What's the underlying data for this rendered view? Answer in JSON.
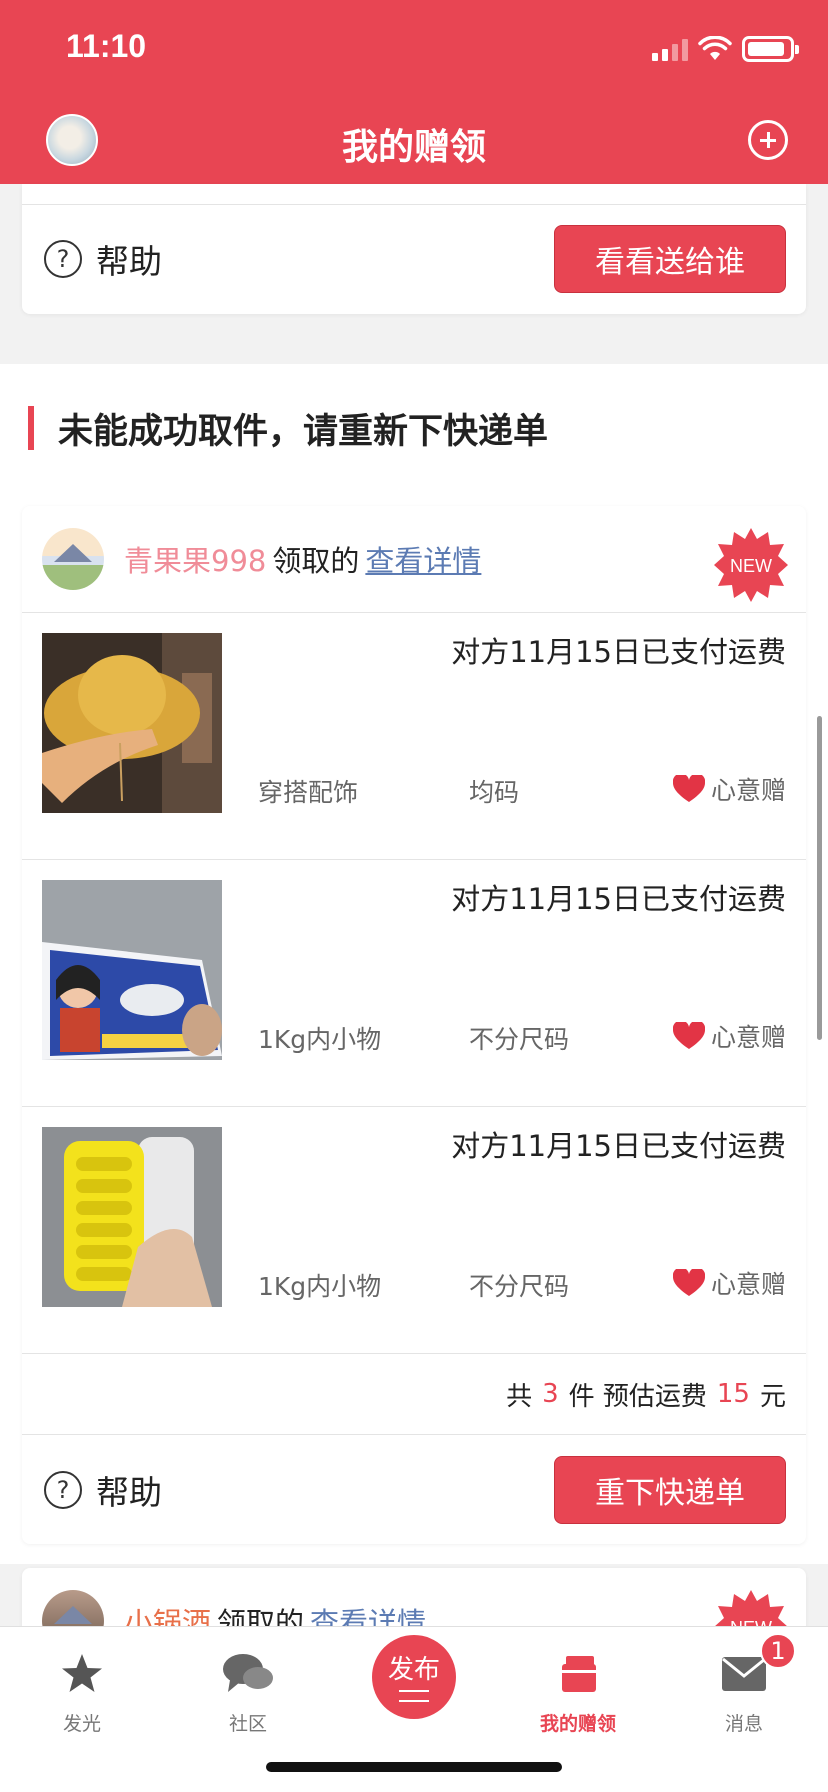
{
  "status": {
    "time": "11:10"
  },
  "header": {
    "title": "我的赠领"
  },
  "top_card": {
    "help_label": "帮助",
    "action_label": "看看送给谁"
  },
  "section": {
    "title": "未能成功取件，请重新下快递单"
  },
  "order": {
    "user_name": "青果果998",
    "received_text": "领取的",
    "detail_link": "查看详情",
    "new_badge": "NEW",
    "items": [
      {
        "paid_text": "对方11月15日已支付运费",
        "category": "穿搭配饰",
        "size": "均码",
        "gift_label": "心意赠"
      },
      {
        "paid_text": "对方11月15日已支付运费",
        "category": "1Kg内小物",
        "size": "不分尺码",
        "gift_label": "心意赠"
      },
      {
        "paid_text": "对方11月15日已支付运费",
        "category": "1Kg内小物",
        "size": "不分尺码",
        "gift_label": "心意赠"
      }
    ],
    "total": {
      "prefix": "共",
      "count": "3",
      "unit": "件 预估运费",
      "fee": "15",
      "currency": "元"
    },
    "help_label": "帮助",
    "action_label": "重下快递单"
  },
  "next_order": {
    "user_name": "小锅酒",
    "received_text": "领取的",
    "detail_link": "查看详情",
    "new_badge": "NEW"
  },
  "tabbar": {
    "tabs": [
      {
        "label": "发光",
        "icon": "star-icon"
      },
      {
        "label": "社区",
        "icon": "chat-bubbles-icon"
      },
      {
        "label": "发布",
        "icon": "publish-icon"
      },
      {
        "label": "我的赠领",
        "icon": "gift-box-icon"
      },
      {
        "label": "消息",
        "icon": "envelope-icon"
      }
    ],
    "message_badge": "1"
  },
  "colors": {
    "accent": "#e84553",
    "link": "#5c7bb3",
    "username": "#f08c98"
  }
}
